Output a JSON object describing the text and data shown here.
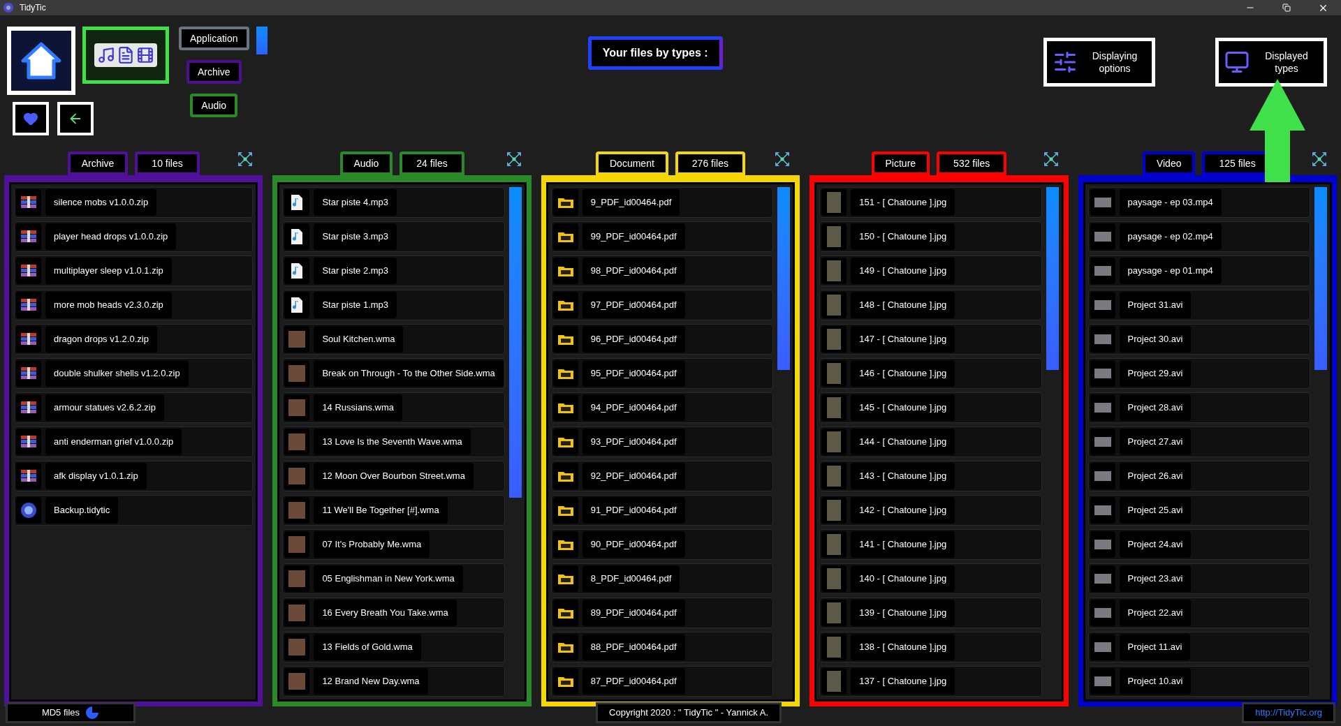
{
  "window": {
    "title": "TidyTic"
  },
  "toolbar": {
    "filters": [
      {
        "label": "Application",
        "color": "#6b7280"
      },
      {
        "label": "Archive",
        "color": "#4b0f8f"
      },
      {
        "label": "Audio",
        "color": "#2a8a2a"
      }
    ],
    "heading": "Your files by types :",
    "buttons": [
      {
        "kind": "options",
        "label": "Displaying options"
      },
      {
        "kind": "types",
        "label": "Displayed types"
      }
    ]
  },
  "columns": [
    {
      "type_label": "Archive",
      "count": "10 files",
      "color": "#50109a",
      "rows": [
        {
          "kind": "zip",
          "name": "silence mobs v1.0.0.zip"
        },
        {
          "kind": "zip",
          "name": "player head drops v1.0.0.zip"
        },
        {
          "kind": "zip",
          "name": "multiplayer sleep v1.0.1.zip"
        },
        {
          "kind": "zip",
          "name": "more mob heads v2.3.0.zip"
        },
        {
          "kind": "zip",
          "name": "dragon drops v1.2.0.zip"
        },
        {
          "kind": "zip",
          "name": "double shulker shells v1.2.0.zip"
        },
        {
          "kind": "zip",
          "name": "armour statues v2.6.2.zip"
        },
        {
          "kind": "zip",
          "name": "anti enderman grief v1.0.0.zip"
        },
        {
          "kind": "zip",
          "name": "afk display v1.0.1.zip"
        },
        {
          "kind": "app",
          "name": "Backup.tidytic"
        }
      ]
    },
    {
      "type_label": "Audio",
      "count": "24 files",
      "color": "#2a8a2a",
      "rows": [
        {
          "kind": "mp3",
          "name": "Star piste 4.mp3"
        },
        {
          "kind": "mp3",
          "name": "Star piste 3.mp3"
        },
        {
          "kind": "mp3",
          "name": "Star piste 2.mp3"
        },
        {
          "kind": "mp3",
          "name": "Star piste 1.mp3"
        },
        {
          "kind": "cover",
          "name": "Soul Kitchen.wma"
        },
        {
          "kind": "cover",
          "name": "Break on Through - To the Other Side.wma"
        },
        {
          "kind": "cover",
          "name": "14 Russians.wma"
        },
        {
          "kind": "cover",
          "name": "13 Love Is the Seventh Wave.wma"
        },
        {
          "kind": "cover",
          "name": "12 Moon Over Bourbon Street.wma"
        },
        {
          "kind": "cover",
          "name": "11 We'll Be Together [#].wma"
        },
        {
          "kind": "cover",
          "name": "07 It's Probably Me.wma"
        },
        {
          "kind": "cover",
          "name": "05 Englishman in New York.wma"
        },
        {
          "kind": "cover",
          "name": "16 Every Breath You Take.wma"
        },
        {
          "kind": "cover",
          "name": "13 Fields of Gold.wma"
        },
        {
          "kind": "cover",
          "name": "12 Brand New Day.wma"
        }
      ]
    },
    {
      "type_label": "Document",
      "count": "276 files",
      "color": "#f5d800",
      "rows": [
        {
          "kind": "pdf",
          "name": "9_PDF_id00464.pdf"
        },
        {
          "kind": "pdf",
          "name": "99_PDF_id00464.pdf"
        },
        {
          "kind": "pdf",
          "name": "98_PDF_id00464.pdf"
        },
        {
          "kind": "pdf",
          "name": "97_PDF_id00464.pdf"
        },
        {
          "kind": "pdf",
          "name": "96_PDF_id00464.pdf"
        },
        {
          "kind": "pdf",
          "name": "95_PDF_id00464.pdf"
        },
        {
          "kind": "pdf",
          "name": "94_PDF_id00464.pdf"
        },
        {
          "kind": "pdf",
          "name": "93_PDF_id00464.pdf"
        },
        {
          "kind": "pdf",
          "name": "92_PDF_id00464.pdf"
        },
        {
          "kind": "pdf",
          "name": "91_PDF_id00464.pdf"
        },
        {
          "kind": "pdf",
          "name": "90_PDF_id00464.pdf"
        },
        {
          "kind": "pdf",
          "name": "8_PDF_id00464.pdf"
        },
        {
          "kind": "pdf",
          "name": "89_PDF_id00464.pdf"
        },
        {
          "kind": "pdf",
          "name": "88_PDF_id00464.pdf"
        },
        {
          "kind": "pdf",
          "name": "87_PDF_id00464.pdf"
        }
      ]
    },
    {
      "type_label": "Picture",
      "count": "532 files",
      "color": "#ff0000",
      "rows": [
        {
          "kind": "photo",
          "name": "151 - [ Chatoune ].jpg"
        },
        {
          "kind": "photo",
          "name": "150 - [ Chatoune ].jpg"
        },
        {
          "kind": "photo",
          "name": "149 - [ Chatoune ].jpg"
        },
        {
          "kind": "photo",
          "name": "148 - [ Chatoune ].jpg"
        },
        {
          "kind": "photo",
          "name": "147 - [ Chatoune ].jpg"
        },
        {
          "kind": "photo",
          "name": "146 - [ Chatoune ].jpg"
        },
        {
          "kind": "photo",
          "name": "145 - [ Chatoune ].jpg"
        },
        {
          "kind": "photo",
          "name": "144 - [ Chatoune ].jpg"
        },
        {
          "kind": "photo",
          "name": "143 - [ Chatoune ].jpg"
        },
        {
          "kind": "photo",
          "name": "142 - [ Chatoune ].jpg"
        },
        {
          "kind": "photo",
          "name": "141 - [ Chatoune ].jpg"
        },
        {
          "kind": "photo",
          "name": "140 - [ Chatoune ].jpg"
        },
        {
          "kind": "photo",
          "name": "139 - [ Chatoune ].jpg"
        },
        {
          "kind": "photo",
          "name": "138 - [ Chatoune ].jpg"
        },
        {
          "kind": "photo",
          "name": "137 - [ Chatoune ].jpg"
        }
      ]
    },
    {
      "type_label": "Video",
      "count": "125 files",
      "color": "#0000d0",
      "rows": [
        {
          "kind": "video",
          "name": "paysage - ep 03.mp4"
        },
        {
          "kind": "video",
          "name": "paysage - ep 02.mp4"
        },
        {
          "kind": "video",
          "name": "paysage - ep 01.mp4"
        },
        {
          "kind": "video",
          "name": "Project 31.avi"
        },
        {
          "kind": "video",
          "name": "Project 30.avi"
        },
        {
          "kind": "video",
          "name": "Project 29.avi"
        },
        {
          "kind": "video",
          "name": "Project 28.avi"
        },
        {
          "kind": "video",
          "name": "Project 27.avi"
        },
        {
          "kind": "video",
          "name": "Project 26.avi"
        },
        {
          "kind": "video",
          "name": "Project 25.avi"
        },
        {
          "kind": "video",
          "name": "Project 24.avi"
        },
        {
          "kind": "video",
          "name": "Project 23.avi"
        },
        {
          "kind": "video",
          "name": "Project 22.avi"
        },
        {
          "kind": "video",
          "name": "Project 11.avi"
        },
        {
          "kind": "video",
          "name": "Project 10.avi"
        }
      ]
    }
  ],
  "footer": {
    "md5": "MD5 files",
    "copyright": "Copyright 2020 : \" TidyTic \" - Yannick A.",
    "link": "http://TidyTic.org"
  }
}
